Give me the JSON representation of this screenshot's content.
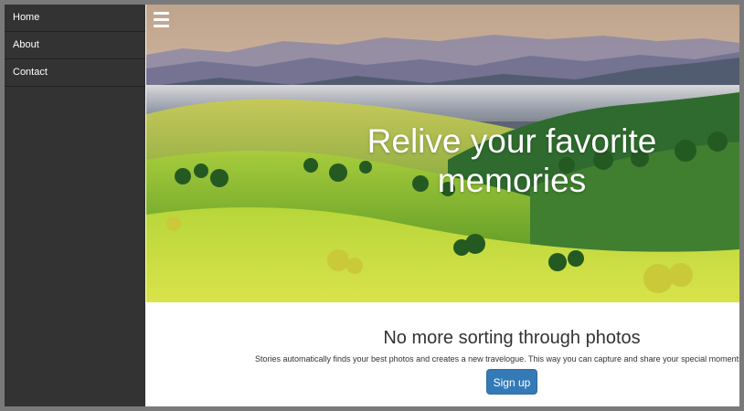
{
  "sidebar": {
    "items": [
      {
        "label": "Home"
      },
      {
        "label": "About"
      },
      {
        "label": "Contact"
      }
    ]
  },
  "header": {
    "menu_icon": "hamburger-menu-icon"
  },
  "hero": {
    "title": "Relive your favorite memories",
    "image": "mountain-landscape-photo"
  },
  "content": {
    "heading": "No more sorting through photos",
    "text": "Stories automatically finds your best photos and creates a new travelogue. This way you can capture and share your special moments in fresh n",
    "button_label": "Sign up"
  },
  "colors": {
    "sidebar_bg": "#333333",
    "button_bg": "#337ab7",
    "page_bg": "#ffffff",
    "window_bg": "#7a7a7a"
  }
}
